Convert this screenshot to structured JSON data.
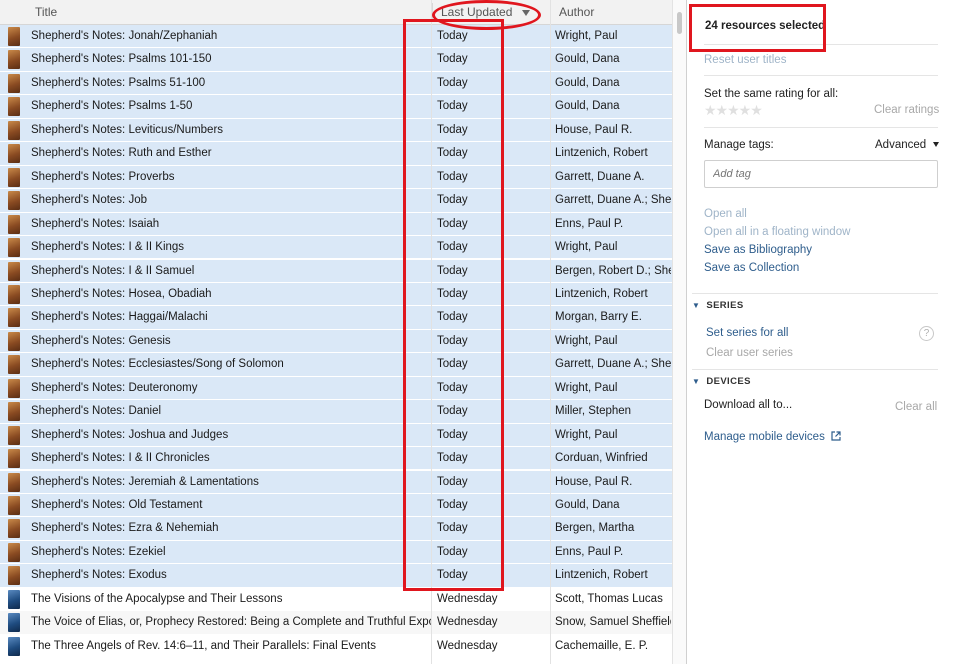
{
  "header": {
    "title_col": "Title",
    "date_col": "Last Updated",
    "author_col": "Author",
    "sort_indicator": "sort-descending-arrow"
  },
  "rows": [
    {
      "title": "Shepherd's Notes: Jonah/Zephaniah",
      "date": "Today",
      "author": "Wright, Paul",
      "selected": true
    },
    {
      "title": "Shepherd's Notes: Psalms 101-150",
      "date": "Today",
      "author": "Gould, Dana",
      "selected": true
    },
    {
      "title": "Shepherd's Notes: Psalms 51-100",
      "date": "Today",
      "author": "Gould, Dana",
      "selected": true
    },
    {
      "title": "Shepherd's Notes: Psalms 1-50",
      "date": "Today",
      "author": "Gould, Dana",
      "selected": true
    },
    {
      "title": "Shepherd's Notes: Leviticus/Numbers",
      "date": "Today",
      "author": "House, Paul R.",
      "selected": true
    },
    {
      "title": "Shepherd's Notes: Ruth and Esther",
      "date": "Today",
      "author": "Lintzenich, Robert",
      "selected": true
    },
    {
      "title": "Shepherd's Notes: Proverbs",
      "date": "Today",
      "author": "Garrett, Duane A.",
      "selected": true
    },
    {
      "title": "Shepherd's Notes: Job",
      "date": "Today",
      "author": "Garrett, Duane A.; Shepl",
      "selected": true
    },
    {
      "title": "Shepherd's Notes: Isaiah",
      "date": "Today",
      "author": "Enns, Paul P.",
      "selected": true
    },
    {
      "title": "Shepherd's Notes: I & II Kings",
      "date": "Today",
      "author": "Wright, Paul",
      "selected": true
    },
    {
      "title": "Shepherd's Notes: I & II Samuel",
      "date": "Today",
      "author": "Bergen, Robert D.; Shep",
      "selected": true
    },
    {
      "title": "Shepherd's Notes: Hosea, Obadiah",
      "date": "Today",
      "author": "Lintzenich, Robert",
      "selected": true
    },
    {
      "title": "Shepherd's Notes: Haggai/Malachi",
      "date": "Today",
      "author": "Morgan, Barry E.",
      "selected": true
    },
    {
      "title": "Shepherd's Notes: Genesis",
      "date": "Today",
      "author": "Wright, Paul",
      "selected": true
    },
    {
      "title": "Shepherd's Notes: Ecclesiastes/Song of Solomon",
      "date": "Today",
      "author": "Garrett, Duane A.; Shepl",
      "selected": true
    },
    {
      "title": "Shepherd's Notes: Deuteronomy",
      "date": "Today",
      "author": "Wright, Paul",
      "selected": true
    },
    {
      "title": "Shepherd's Notes: Daniel",
      "date": "Today",
      "author": "Miller, Stephen",
      "selected": true
    },
    {
      "title": "Shepherd's Notes: Joshua and Judges",
      "date": "Today",
      "author": "Wright, Paul",
      "selected": true
    },
    {
      "title": "Shepherd's Notes: I & II Chronicles",
      "date": "Today",
      "author": "Corduan, Winfried",
      "selected": true
    },
    {
      "title": "Shepherd's Notes: Jeremiah & Lamentations",
      "date": "Today",
      "author": "House, Paul R.",
      "selected": true
    },
    {
      "title": "Shepherd's Notes: Old Testament",
      "date": "Today",
      "author": "Gould, Dana",
      "selected": true
    },
    {
      "title": "Shepherd's Notes: Ezra & Nehemiah",
      "date": "Today",
      "author": "Bergen, Martha",
      "selected": true
    },
    {
      "title": "Shepherd's Notes: Ezekiel",
      "date": "Today",
      "author": "Enns, Paul P.",
      "selected": true
    },
    {
      "title": "Shepherd's Notes: Exodus",
      "date": "Today",
      "author": "Lintzenich, Robert",
      "selected": true
    },
    {
      "title": "The Visions of the Apocalypse and Their Lessons",
      "date": "Wednesday",
      "author": "Scott, Thomas Lucas",
      "selected": false
    },
    {
      "title": "The Voice of Elias, or, Prophecy Restored: Being a Complete and Truthful Exposit...",
      "date": "Wednesday",
      "author": "Snow, Samuel Sheffield",
      "selected": false
    },
    {
      "title": "The Three Angels of Rev. 14:6–11, and Their Parallels: Final Events",
      "date": "Wednesday",
      "author": "Cachemaille, E. P.",
      "selected": false
    }
  ],
  "panel": {
    "selected_count": "24 resources selected",
    "reset_titles": "Reset user titles",
    "rating_label": "Set the same rating for all:",
    "stars": "★★★★★",
    "clear_ratings": "Clear ratings",
    "manage_tags": "Manage tags:",
    "advanced": "Advanced",
    "tag_placeholder": "Add tag",
    "open_all": "Open all",
    "open_floating": "Open all in a floating window",
    "save_bibliography": "Save as Bibliography",
    "save_collection": "Save as Collection",
    "series_heading": "SERIES",
    "set_series": "Set series for all",
    "help": "?",
    "clear_series": "Clear user series",
    "devices_heading": "DEVICES",
    "download_all": "Download all to...",
    "clear_all": "Clear all",
    "manage_devices": "Manage mobile devices"
  },
  "colors": {
    "selection": "#dae8f7",
    "link": "#2e5d8c",
    "annotation": "#e0161e"
  }
}
